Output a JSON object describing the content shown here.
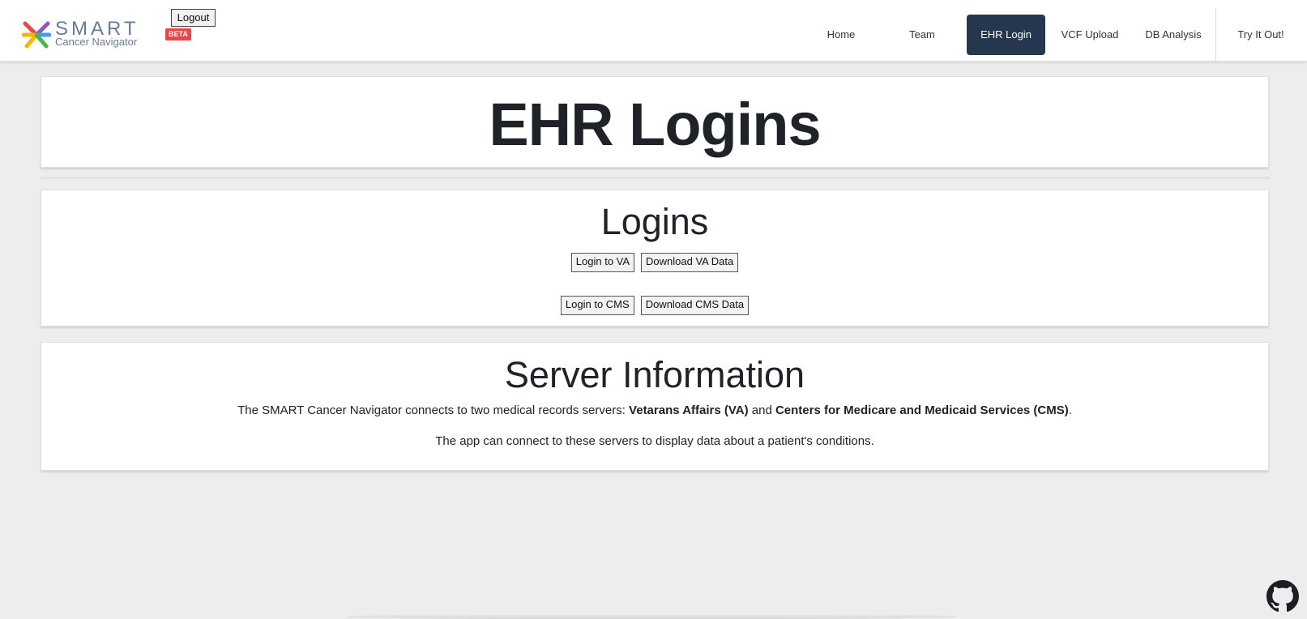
{
  "brand": {
    "name": "SMART",
    "subtitle": "Cancer Navigator",
    "badge": "BETA",
    "colors": {
      "yellow": "#f5b800",
      "red": "#e54848",
      "purple": "#8b59c9",
      "blue": "#3aa0e8",
      "green": "#49b84a"
    }
  },
  "header": {
    "logout_label": "Logout",
    "nav": [
      {
        "label": "Home"
      },
      {
        "label": "Team"
      },
      {
        "label": "EHR Login",
        "active": true
      },
      {
        "label": "VCF Upload"
      },
      {
        "label": "DB Analysis"
      },
      {
        "label": "Try It Out!"
      }
    ],
    "active_color": "#25374f"
  },
  "main": {
    "title": "EHR Logins",
    "logins": {
      "heading": "Logins",
      "va_login": "Login to VA",
      "va_download": "Download VA Data",
      "cms_login": "Login to CMS",
      "cms_download": "Download CMS Data"
    },
    "server": {
      "heading": "Server Information",
      "line1_prefix": "The SMART Cancer Navigator connects to two medical records servers: ",
      "va_name": "Vetarans Affairs (VA)",
      "line1_and": " and ",
      "cms_name": "Centers for Medicare and Medicaid Services (CMS)",
      "line1_end": ".",
      "line2": "The app can connect to these servers to display data about a patient's conditions."
    }
  },
  "footer": {
    "github_icon": "github-icon"
  }
}
